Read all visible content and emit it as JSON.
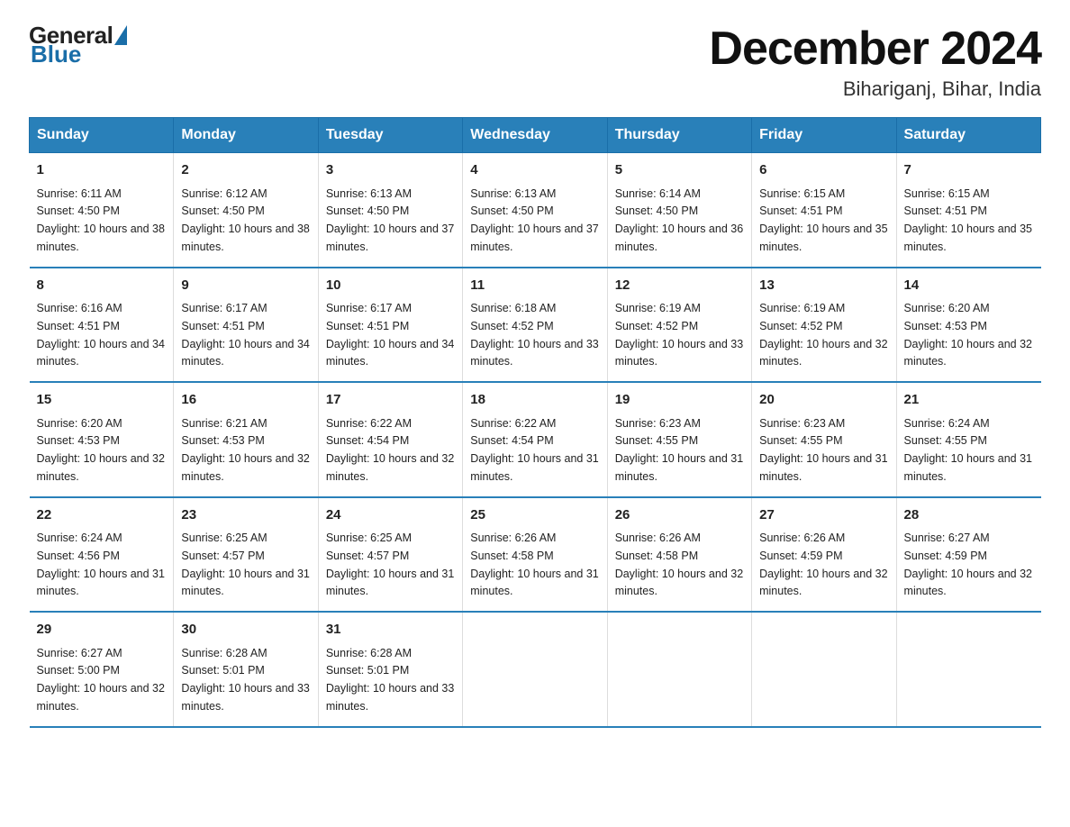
{
  "logo": {
    "general": "General",
    "blue": "Blue"
  },
  "title": "December 2024",
  "subtitle": "Bihariganj, Bihar, India",
  "days_of_week": [
    "Sunday",
    "Monday",
    "Tuesday",
    "Wednesday",
    "Thursday",
    "Friday",
    "Saturday"
  ],
  "weeks": [
    [
      {
        "day": "1",
        "sunrise": "6:11 AM",
        "sunset": "4:50 PM",
        "daylight": "10 hours and 38 minutes."
      },
      {
        "day": "2",
        "sunrise": "6:12 AM",
        "sunset": "4:50 PM",
        "daylight": "10 hours and 38 minutes."
      },
      {
        "day": "3",
        "sunrise": "6:13 AM",
        "sunset": "4:50 PM",
        "daylight": "10 hours and 37 minutes."
      },
      {
        "day": "4",
        "sunrise": "6:13 AM",
        "sunset": "4:50 PM",
        "daylight": "10 hours and 37 minutes."
      },
      {
        "day": "5",
        "sunrise": "6:14 AM",
        "sunset": "4:50 PM",
        "daylight": "10 hours and 36 minutes."
      },
      {
        "day": "6",
        "sunrise": "6:15 AM",
        "sunset": "4:51 PM",
        "daylight": "10 hours and 35 minutes."
      },
      {
        "day": "7",
        "sunrise": "6:15 AM",
        "sunset": "4:51 PM",
        "daylight": "10 hours and 35 minutes."
      }
    ],
    [
      {
        "day": "8",
        "sunrise": "6:16 AM",
        "sunset": "4:51 PM",
        "daylight": "10 hours and 34 minutes."
      },
      {
        "day": "9",
        "sunrise": "6:17 AM",
        "sunset": "4:51 PM",
        "daylight": "10 hours and 34 minutes."
      },
      {
        "day": "10",
        "sunrise": "6:17 AM",
        "sunset": "4:51 PM",
        "daylight": "10 hours and 34 minutes."
      },
      {
        "day": "11",
        "sunrise": "6:18 AM",
        "sunset": "4:52 PM",
        "daylight": "10 hours and 33 minutes."
      },
      {
        "day": "12",
        "sunrise": "6:19 AM",
        "sunset": "4:52 PM",
        "daylight": "10 hours and 33 minutes."
      },
      {
        "day": "13",
        "sunrise": "6:19 AM",
        "sunset": "4:52 PM",
        "daylight": "10 hours and 32 minutes."
      },
      {
        "day": "14",
        "sunrise": "6:20 AM",
        "sunset": "4:53 PM",
        "daylight": "10 hours and 32 minutes."
      }
    ],
    [
      {
        "day": "15",
        "sunrise": "6:20 AM",
        "sunset": "4:53 PM",
        "daylight": "10 hours and 32 minutes."
      },
      {
        "day": "16",
        "sunrise": "6:21 AM",
        "sunset": "4:53 PM",
        "daylight": "10 hours and 32 minutes."
      },
      {
        "day": "17",
        "sunrise": "6:22 AM",
        "sunset": "4:54 PM",
        "daylight": "10 hours and 32 minutes."
      },
      {
        "day": "18",
        "sunrise": "6:22 AM",
        "sunset": "4:54 PM",
        "daylight": "10 hours and 31 minutes."
      },
      {
        "day": "19",
        "sunrise": "6:23 AM",
        "sunset": "4:55 PM",
        "daylight": "10 hours and 31 minutes."
      },
      {
        "day": "20",
        "sunrise": "6:23 AM",
        "sunset": "4:55 PM",
        "daylight": "10 hours and 31 minutes."
      },
      {
        "day": "21",
        "sunrise": "6:24 AM",
        "sunset": "4:55 PM",
        "daylight": "10 hours and 31 minutes."
      }
    ],
    [
      {
        "day": "22",
        "sunrise": "6:24 AM",
        "sunset": "4:56 PM",
        "daylight": "10 hours and 31 minutes."
      },
      {
        "day": "23",
        "sunrise": "6:25 AM",
        "sunset": "4:57 PM",
        "daylight": "10 hours and 31 minutes."
      },
      {
        "day": "24",
        "sunrise": "6:25 AM",
        "sunset": "4:57 PM",
        "daylight": "10 hours and 31 minutes."
      },
      {
        "day": "25",
        "sunrise": "6:26 AM",
        "sunset": "4:58 PM",
        "daylight": "10 hours and 31 minutes."
      },
      {
        "day": "26",
        "sunrise": "6:26 AM",
        "sunset": "4:58 PM",
        "daylight": "10 hours and 32 minutes."
      },
      {
        "day": "27",
        "sunrise": "6:26 AM",
        "sunset": "4:59 PM",
        "daylight": "10 hours and 32 minutes."
      },
      {
        "day": "28",
        "sunrise": "6:27 AM",
        "sunset": "4:59 PM",
        "daylight": "10 hours and 32 minutes."
      }
    ],
    [
      {
        "day": "29",
        "sunrise": "6:27 AM",
        "sunset": "5:00 PM",
        "daylight": "10 hours and 32 minutes."
      },
      {
        "day": "30",
        "sunrise": "6:28 AM",
        "sunset": "5:01 PM",
        "daylight": "10 hours and 33 minutes."
      },
      {
        "day": "31",
        "sunrise": "6:28 AM",
        "sunset": "5:01 PM",
        "daylight": "10 hours and 33 minutes."
      },
      null,
      null,
      null,
      null
    ]
  ]
}
